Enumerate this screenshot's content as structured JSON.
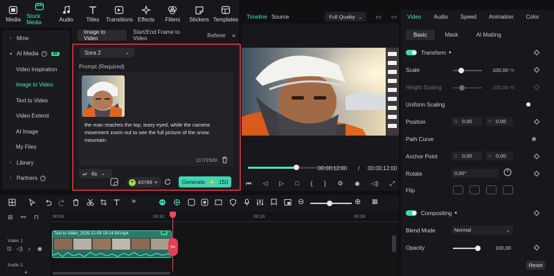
{
  "toolbar": {
    "items": [
      {
        "label": "Media",
        "icon": "media-icon"
      },
      {
        "label": "Stock Media",
        "icon": "stock-media-icon",
        "active": true
      },
      {
        "label": "Audio",
        "icon": "music-note-icon"
      },
      {
        "label": "Titles",
        "icon": "text-t-icon"
      },
      {
        "label": "Transitions",
        "icon": "transitions-icon"
      },
      {
        "label": "Effects",
        "icon": "sparkle-icon"
      },
      {
        "label": "Filters",
        "icon": "filters-icon"
      },
      {
        "label": "Stickers",
        "icon": "sticker-icon"
      },
      {
        "label": "Templates",
        "icon": "templates-icon"
      }
    ]
  },
  "sidebar": {
    "items": [
      {
        "label": "Mine",
        "type": "group"
      },
      {
        "label": "AI Media",
        "type": "group-open",
        "badge": "AI"
      },
      {
        "label": "Video Inspiration"
      },
      {
        "label": "Image to Video",
        "active": true
      },
      {
        "label": "Text to Video"
      },
      {
        "label": "Video Extend"
      },
      {
        "label": "AI Image"
      },
      {
        "label": "My Files"
      },
      {
        "label": "Library",
        "type": "group"
      },
      {
        "label": "Partners",
        "type": "group"
      }
    ]
  },
  "center": {
    "tabs": [
      "Image to Video",
      "Start/End Frame to Video",
      "Referer"
    ],
    "model": "Sora 2",
    "prompt_label": "Prompt (Required)",
    "prompt_text": "the man reaches the top, teary eyed, while the camera movement zoom out to see the full picture of the snow mountain.",
    "char_count": "117/1500",
    "duration": "4s",
    "credits": "43789",
    "generate_label": "Generate",
    "generate_cost": "150"
  },
  "player": {
    "tab_timeline": "Timeline",
    "tab_source": "Source",
    "quality": "Full Quality",
    "current_time": "00:00:12:00",
    "separator": "/",
    "total_time": "00:00:12:00",
    "progress": 0.5
  },
  "right": {
    "tabs": [
      "Video",
      "Audio",
      "Speed",
      "Animation",
      "Color"
    ],
    "subtabs": [
      "Basic",
      "Mask",
      "AI Matting"
    ],
    "transform_label": "Transform",
    "scale_label": "Scale",
    "scale_value": "100,00",
    "scale_unit": "%",
    "scale_level": 0.2,
    "height_scaling_label": "Height Scaling",
    "height_scaling_value": "100,00",
    "height_scaling_unit": "%",
    "uniform_scaling_label": "Uniform Scaling",
    "position_label": "Position",
    "position_x": "0,00",
    "position_y": "0,00",
    "path_curve_label": "Path Curve",
    "anchor_label": "Anchor Point",
    "anchor_x": "0,00",
    "anchor_y": "0,00",
    "rotate_label": "Rotate",
    "rotate_value": "0,00°",
    "flip_label": "Flip",
    "compositing_label": "Compositing",
    "blend_mode_label": "Blend Mode",
    "blend_mode_value": "Normal",
    "opacity_label": "Opacity",
    "opacity_value": "100,00",
    "opacity_level": 1.0,
    "reset_label": "Reset",
    "axis_x": "X",
    "axis_y": "Y"
  },
  "timeline": {
    "ruler": [
      "00:00",
      "00:10",
      "00:20",
      "00:30"
    ],
    "track_video": "Video 1",
    "track_audio": "Audio 1",
    "clip_title": "Text to Video_2025-12-09 19-14-54.mp4",
    "clip_badge": "AI"
  }
}
